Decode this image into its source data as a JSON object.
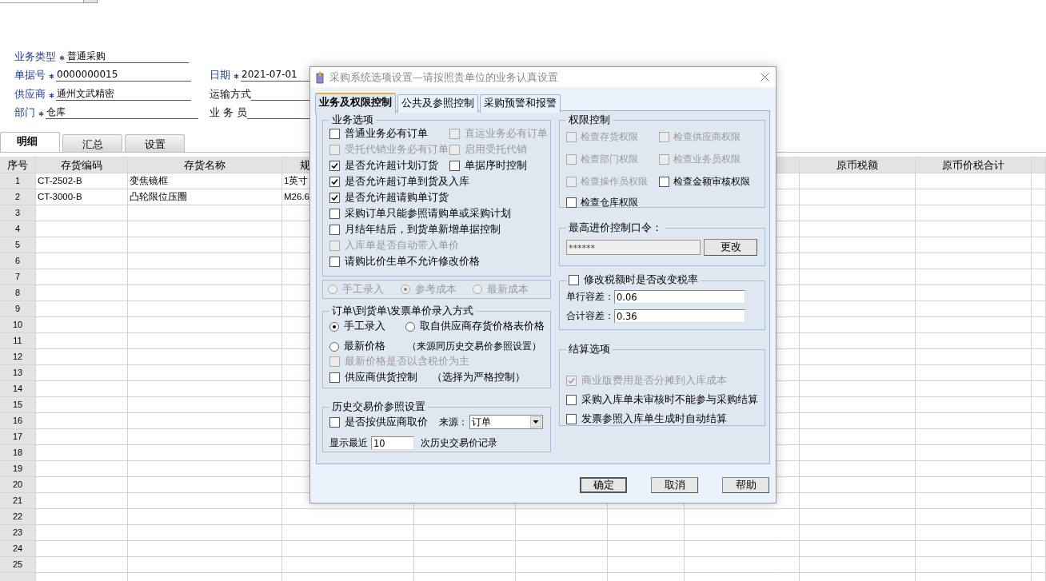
{
  "form": {
    "rows": [
      [
        {
          "label": "业务类型",
          "required": true,
          "value": "普通采购"
        }
      ],
      [
        {
          "label": "单据号",
          "required": true,
          "value": "0000000015"
        },
        {
          "label": "日期",
          "required": true,
          "value": "2021-07-01"
        }
      ],
      [
        {
          "label": "供应商",
          "required": true,
          "value": "通州文武精密"
        },
        {
          "label": "运输方式",
          "required": false
        }
      ],
      [
        {
          "label": "部门",
          "required": true,
          "value": "仓库"
        },
        {
          "label": "业 务 员",
          "required": false
        }
      ]
    ]
  },
  "tabs": [
    {
      "label": "明细",
      "selected": true
    },
    {
      "label": "汇总",
      "selected": false
    },
    {
      "label": "设置",
      "selected": false
    }
  ],
  "table": {
    "columns": [
      "序号",
      "存货编码",
      "存货名称",
      "规",
      "原币税额",
      "原币价税合计"
    ],
    "rows": [
      {
        "cells": [
          "1",
          "CT-2502-B",
          "变焦镜框",
          "1英寸"
        ]
      },
      {
        "cells": [
          "2",
          "CT-3000-B",
          "凸轮限位压圈",
          "M26.6"
        ]
      },
      {
        "cells": [
          "3"
        ]
      },
      {
        "cells": [
          "4"
        ]
      },
      {
        "cells": [
          "5"
        ]
      },
      {
        "cells": [
          "6"
        ]
      },
      {
        "cells": [
          "7"
        ]
      },
      {
        "cells": [
          "8"
        ]
      },
      {
        "cells": [
          "9"
        ]
      },
      {
        "cells": [
          "10"
        ]
      },
      {
        "cells": [
          "11"
        ]
      },
      {
        "cells": [
          "12"
        ]
      },
      {
        "cells": [
          "13"
        ]
      },
      {
        "cells": [
          "14"
        ]
      },
      {
        "cells": [
          "15"
        ]
      },
      {
        "cells": [
          "16"
        ]
      },
      {
        "cells": [
          "17"
        ]
      },
      {
        "cells": [
          "18"
        ]
      },
      {
        "cells": [
          "19"
        ]
      },
      {
        "cells": [
          "20"
        ]
      },
      {
        "cells": [
          "21"
        ]
      },
      {
        "cells": [
          "22"
        ]
      },
      {
        "cells": [
          "23"
        ]
      },
      {
        "cells": [
          "24"
        ]
      },
      {
        "cells": [
          "25"
        ]
      }
    ]
  },
  "dialog": {
    "title": "采购系统选项设置—请按照贵单位的业务认真设置",
    "tabs": [
      {
        "label": "业务及权限控制",
        "selected": true
      },
      {
        "label": "公共及参照控制",
        "selected": false
      },
      {
        "label": "采购预警和报警",
        "selected": false
      }
    ],
    "business_options": {
      "title": "业务选项",
      "rows": [
        [
          {
            "label": "普通业务必有订单",
            "checked": false,
            "disabled": false
          },
          {
            "label": "直运业务必有订单",
            "checked": false,
            "disabled": true
          }
        ],
        [
          {
            "label": "受托代销业务必有订单",
            "checked": false,
            "disabled": true
          },
          {
            "label": "启用受托代销",
            "checked": false,
            "disabled": true
          }
        ],
        [
          {
            "label": "是否允许超计划订货",
            "checked": true,
            "disabled": false
          },
          {
            "label": "单据序时控制",
            "checked": false,
            "disabled": false
          }
        ],
        [
          {
            "label": "是否允许超订单到货及入库",
            "checked": true,
            "disabled": false
          }
        ],
        [
          {
            "label": "是否允许超请购单订货",
            "checked": true,
            "disabled": false
          }
        ],
        [
          {
            "label": "采购订单只能参照请购单或采购计划",
            "checked": false,
            "disabled": false
          }
        ],
        [
          {
            "label": "月结年结后，到货单新增单据控制",
            "checked": false,
            "disabled": false
          }
        ],
        [
          {
            "label": "入库单是否自动带入单价",
            "checked": false,
            "disabled": true
          }
        ],
        [
          {
            "label": "请购比价生单不允许修改价格",
            "checked": false,
            "disabled": false
          }
        ]
      ]
    },
    "cost_radios": [
      {
        "label": "手工录入",
        "selected": false,
        "disabled": true
      },
      {
        "label": "参考成本",
        "selected": true,
        "disabled": true
      },
      {
        "label": "最新成本",
        "selected": false,
        "disabled": true
      }
    ],
    "price_entry": {
      "title": "订单\\到货单\\发票单价录入方式",
      "radios": [
        {
          "label": "手工录入",
          "selected": true
        },
        {
          "label": "取自供应商存货价格表价格",
          "selected": false
        },
        {
          "label": "最新价格",
          "selected": false
        }
      ],
      "note": "（来源同历史交易价参照设置）",
      "checks": [
        {
          "label": "最新价格是否以含税价为主",
          "checked": false,
          "disabled": true
        },
        {
          "label": "供应商供货控制",
          "checked": false,
          "disabled": false,
          "note": "（选择为严格控制）"
        }
      ]
    },
    "history": {
      "title": "历史交易价参照设置",
      "check": {
        "label": "是否按供应商取价",
        "checked": false,
        "disabled": false
      },
      "source_label": "来源：",
      "source_value": "订单",
      "recent_prefix": "显示最近",
      "recent_value": "10",
      "recent_suffix": "次历史交易价记录"
    },
    "permissions": {
      "title": "权限控制",
      "rows": [
        [
          {
            "label": "检查存货权限",
            "checked": false,
            "disabled": true
          },
          {
            "label": "检查供应商权限",
            "checked": false,
            "disabled": true
          }
        ],
        [
          {
            "label": "检查部门权限",
            "checked": false,
            "disabled": true
          },
          {
            "label": "检查业务员权限",
            "checked": false,
            "disabled": true
          }
        ],
        [
          {
            "label": "检查操作员权限",
            "checked": false,
            "disabled": true
          },
          {
            "label": "检查金额审核权限",
            "checked": false,
            "disabled": false
          }
        ],
        [
          {
            "label": "检查仓库权限",
            "checked": false,
            "disabled": false
          }
        ]
      ]
    },
    "password": {
      "title": "最高进价控制口令：",
      "value": "******",
      "button": "更改"
    },
    "tax": {
      "check": {
        "label": "修改税额时是否改变税率",
        "checked": false,
        "disabled": false
      },
      "fields": [
        {
          "label": "单行容差：",
          "value": "0.06"
        },
        {
          "label": "合计容差：",
          "value": "0.36"
        }
      ]
    },
    "settlement": {
      "title": "结算选项",
      "items": [
        {
          "label": "商业版费用是否分摊到入库成本",
          "checked": true,
          "disabled": true
        },
        {
          "label": "采购入库单未审核时不能参与采购结算",
          "checked": false,
          "disabled": false
        },
        {
          "label": "发票参照入库单生成时自动结算",
          "checked": false,
          "disabled": false
        }
      ]
    },
    "buttons": [
      {
        "label": "确定",
        "default": true
      },
      {
        "label": "取消",
        "default": false
      },
      {
        "label": "帮助",
        "default": false
      }
    ]
  }
}
